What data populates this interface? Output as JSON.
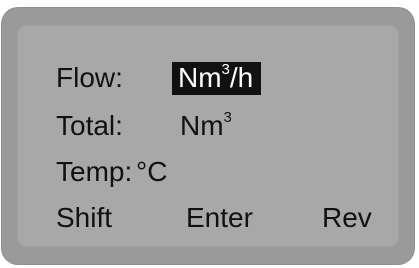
{
  "display": {
    "rows": [
      {
        "label": "Flow:",
        "unit_base": "Nm",
        "unit_sup": "3",
        "unit_suffix": "/h",
        "highlighted": true
      },
      {
        "label": "Total:",
        "unit_base": "Nm",
        "unit_sup": "3",
        "unit_suffix": "",
        "highlighted": false
      },
      {
        "label": "Temp:",
        "unit_base": "",
        "unit_sup": "",
        "unit_suffix": "°C",
        "highlighted": false
      }
    ],
    "keys": {
      "shift": "Shift",
      "enter": "Enter",
      "rev": "Rev"
    }
  },
  "colors": {
    "bezel": "#9a9a9a",
    "screen": "#a8a8a8",
    "text": "#111111",
    "highlight_bg": "#111111",
    "highlight_fg": "#ffffff"
  }
}
